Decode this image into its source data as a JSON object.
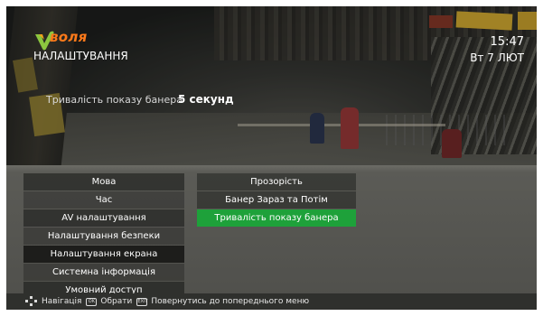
{
  "header": {
    "brand": "воля",
    "title": "НАЛАШТУВАННЯ",
    "time": "15:47",
    "date": "Вт 7 ЛЮТ"
  },
  "banner_setting": {
    "label": "Тривалість показу банера",
    "value": "5 секунд"
  },
  "menu": {
    "left": [
      {
        "label": "Мова"
      },
      {
        "label": "Час"
      },
      {
        "label": "AV налаштування"
      },
      {
        "label": "Налаштування безпеки"
      },
      {
        "label": "Налаштування екрана"
      },
      {
        "label": "Системна інформація"
      },
      {
        "label": "Умовний доступ"
      }
    ],
    "left_selected_index": 4,
    "right": [
      {
        "label": "Прозорість"
      },
      {
        "label": "Банер Зараз та Потім"
      },
      {
        "label": "Тривалість показу банера"
      }
    ],
    "right_focused_index": 2
  },
  "footer": {
    "nav_label": "Навігація",
    "ok_key": "OK",
    "select_label": "Обрати",
    "back_key": "EXIT",
    "back_label": "Повернутись до попереднього меню"
  },
  "colors": {
    "focus": "#1ea13a",
    "brand": "#ff7a1a"
  },
  "icons": [
    "volia-logo-icon",
    "navigation-arrows-icon",
    "ok-key-icon",
    "exit-key-icon"
  ]
}
